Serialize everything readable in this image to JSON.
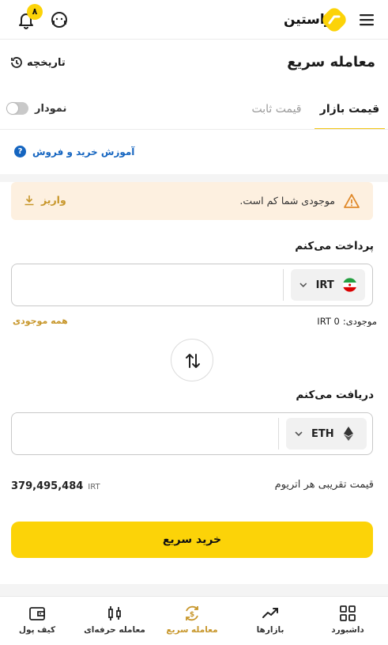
{
  "header": {
    "logo_text": "راستین",
    "notification_count": "۸"
  },
  "page": {
    "title": "معامله سریع",
    "history_label": "تاریخچه"
  },
  "tabs": [
    {
      "label": "قیمت بازار",
      "active": true
    },
    {
      "label": "قیمت ثابت",
      "active": false
    }
  ],
  "chart_toggle": {
    "label": "نمودار",
    "on": false
  },
  "education_link": "آموزش خرید و فروش",
  "warning": {
    "text": "موجودی شما کم است.",
    "action_label": "واریز"
  },
  "pay": {
    "label": "پرداخت می‌کنم",
    "amount": "",
    "currency": "IRT",
    "all_balance_label": "همه موجودی",
    "balance_label": "موجودی:",
    "balance_value": "IRT 0"
  },
  "receive": {
    "label": "دریافت می‌کنم",
    "amount": "",
    "currency": "ETH"
  },
  "approx_price": {
    "label": "قیمت تقریبی هر اتریوم",
    "value": "379,495,484",
    "unit": "IRT"
  },
  "buy_button": "خرید سریع",
  "bottom_nav": [
    {
      "label": "داشبورد",
      "icon": "dashboard-icon"
    },
    {
      "label": "بازارها",
      "icon": "markets-icon"
    },
    {
      "label": "معامله سریع",
      "icon": "quick-trade-icon",
      "active": true
    },
    {
      "label": "معامله حرفه‌ای",
      "icon": "pro-trade-icon"
    },
    {
      "label": "کیف پول",
      "icon": "wallet-icon"
    }
  ],
  "colors": {
    "accent": "#fcd308",
    "gold_text": "#c7962a",
    "link_blue": "#1565c0",
    "warning_bg": "#fdf0e0"
  }
}
